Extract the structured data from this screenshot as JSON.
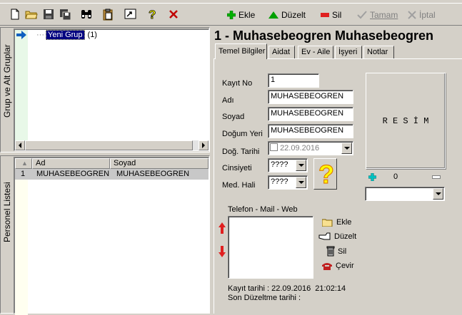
{
  "toolbar": {
    "icons": [
      "new-document-icon",
      "open-folder-icon",
      "save-icon",
      "save-all-icon",
      "binoculars-icon",
      "clipboard-icon",
      "export-icon",
      "help-icon",
      "close-icon"
    ]
  },
  "actions": {
    "add": "Ekle",
    "edit": "Düzelt",
    "delete": "Sil",
    "ok": "Tamam",
    "cancel": "İptal"
  },
  "groups_panel": {
    "title": "Grup ve Alt Gruplar",
    "tree_item": "Yeni Grup",
    "tree_count": "(1)"
  },
  "personnel_panel": {
    "title": "Personel Listesi",
    "columns": [
      "Ad",
      "Soyad"
    ],
    "rows": [
      {
        "num": "1",
        "ad": "MUHASEBEOGREN",
        "soyad": "MUHASEBEOGREN"
      }
    ]
  },
  "record": {
    "header": "1 - Muhasebeogren Muhasebeogren",
    "tabs": [
      "Temel Bilgiler",
      "Aidat",
      "Ev - Aile",
      "İşyeri",
      "Notlar"
    ],
    "labels": {
      "kayit_no": "Kayıt No",
      "adi": "Adı",
      "soyad": "Soyad",
      "dogum_yeri": "Doğum Yeri",
      "dogum_tarihi": "Doğ. Tarihi",
      "cinsiyet": "Cinsiyeti",
      "med_hali": "Med. Hali"
    },
    "values": {
      "kayit_no": "1",
      "adi": "MUHASEBEOGREN",
      "soyad": "MUHASEBEOGREN",
      "dogum_yeri": "MUHASEBEOGREN",
      "dogum_tarihi": "22.09.2016",
      "cinsiyet": "????",
      "med_hali": "????"
    },
    "photo_label": "R E S İ M",
    "photo_counter": "0",
    "contact": {
      "title": "Telefon - Mail - Web",
      "add": "Ekle",
      "edit": "Düzelt",
      "delete": "Sil",
      "dial": "Çevir"
    },
    "footer": {
      "created": "Kayıt tarihi : 22.09.2016  21:02:14",
      "modified": "Son Düzeltme tarihi :"
    }
  },
  "colors": {
    "add_green": "#00a000",
    "delete_red": "#e02020",
    "selection_navy": "#000080",
    "help_yellow": "#ffff00",
    "help_orange": "#e08000"
  }
}
